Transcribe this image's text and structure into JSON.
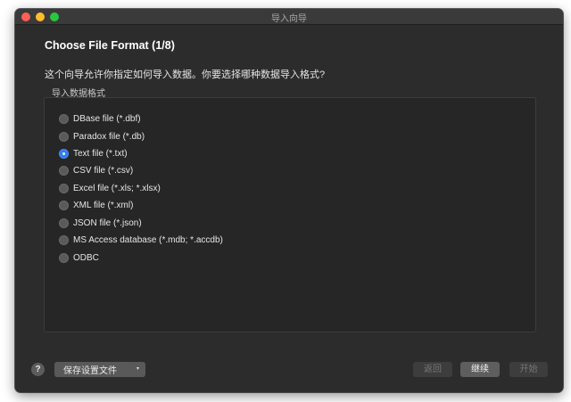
{
  "window": {
    "title": "导入向导"
  },
  "wizard": {
    "heading": "Choose File Format (1/8)",
    "description": "这个向导允许你指定如何导入数据。你要选择哪种数据导入格式?",
    "group_label": "导入数据格式",
    "selected_index": 2,
    "options": [
      {
        "label": "DBase file (*.dbf)"
      },
      {
        "label": "Paradox file (*.db)"
      },
      {
        "label": "Text file (*.txt)"
      },
      {
        "label": "CSV file (*.csv)"
      },
      {
        "label": "Excel file (*.xls; *.xlsx)"
      },
      {
        "label": "XML file (*.xml)"
      },
      {
        "label": "JSON file (*.json)"
      },
      {
        "label": "MS Access database (*.mdb; *.accdb)"
      },
      {
        "label": "ODBC"
      }
    ]
  },
  "footer": {
    "help_label": "?",
    "save_settings_label": "保存设置文件",
    "save_settings_arrow": "▾",
    "back_label": "返回",
    "next_label": "继续",
    "start_label": "开始"
  },
  "colors": {
    "window_bg": "#2c2c2c",
    "accent_radio": "#2f7bf6",
    "close": "#fe5f57",
    "minimize": "#febc2e",
    "maximize": "#28c840"
  }
}
